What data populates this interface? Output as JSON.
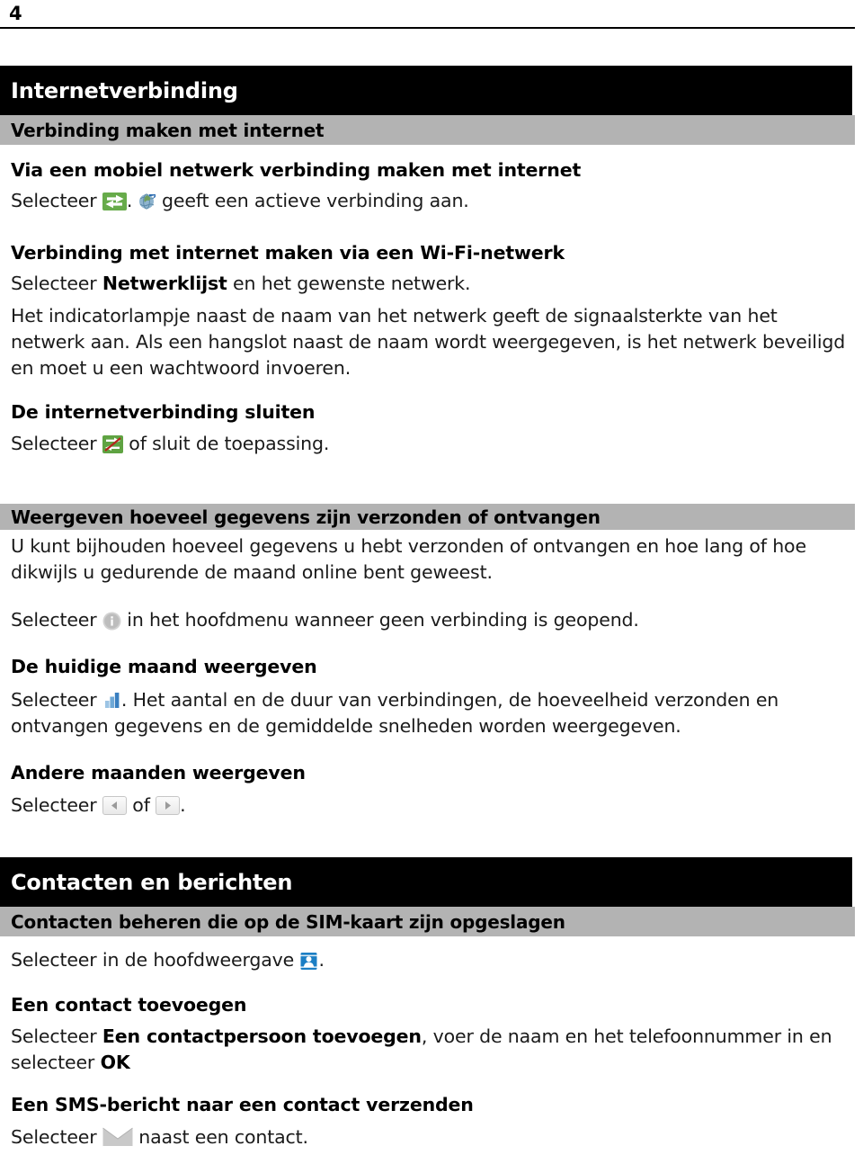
{
  "page": {
    "number": "4"
  },
  "chapters": [
    {
      "title": "Internetverbinding",
      "subtitle": "Verbinding maken met internet"
    },
    {
      "title": "Contacten en berichten",
      "subtitle": "Contacten beheren die op de SIM-kaart zijn opgeslagen"
    }
  ],
  "sections": {
    "mobiel_heading": "Via een mobiel netwerk verbinding maken met internet",
    "mobiel_line_pre": "Selecteer",
    "mobiel_line_mid": ".",
    "mobiel_line_post": "geeft een actieve verbinding aan.",
    "wifi_heading": "Verbinding met internet maken via een Wi-Fi-netwerk",
    "wifi_line1_pre": "Selecteer",
    "wifi_line1_bold": "Netwerklijst",
    "wifi_line1_post": "en het gewenste netwerk.",
    "wifi_para": "Het indicatorlampje naast de naam van het netwerk geeft de signaalsterkte van het netwerk aan. Als een hangslot naast de naam wordt weergegeven, is het netwerk beveiligd en moet u een wachtwoord invoeren.",
    "sluiten_heading": "De internetverbinding sluiten",
    "sluiten_pre": "Selecteer",
    "sluiten_post": "of sluit de toepassing.",
    "weergeven_bar": "Weergeven hoeveel gegevens zijn verzonden of ontvangen",
    "weergeven_para": "U kunt bijhouden hoeveel gegevens u hebt verzonden of ontvangen en hoe lang of hoe dikwijls u gedurende de maand online bent geweest.",
    "weergeven_line_pre": "Selecteer",
    "weergeven_line_post": "in het hoofdmenu wanneer geen verbinding is geopend.",
    "huidige_heading": "De huidige maand weergeven",
    "huidige_pre": "Selecteer",
    "huidige_post": ". Het aantal en de duur van verbindingen, de hoeveelheid verzonden en ontvangen gegevens en de gemiddelde snelheden worden weergegeven.",
    "andere_heading": "Andere maanden weergeven",
    "andere_pre": "Selecteer",
    "andere_mid": "of",
    "andere_post": ".",
    "simkaart_pre": "Selecteer in de hoofdweergave",
    "simkaart_post": ".",
    "contact_toevoegen_heading": "Een contact toevoegen",
    "contact_toevoegen_pre": "Selecteer",
    "contact_toevoegen_bold": "Een contactpersoon toevoegen",
    "contact_toevoegen_mid": ", voer de naam en het telefoonnummer in en selecteer",
    "contact_toevoegen_bold2": "OK",
    "sms_heading": "Een SMS-bericht naar een contact verzenden",
    "sms_pre": "Selecteer",
    "sms_post": "naast een contact."
  },
  "icons": {
    "transfer": "transfer-arrows-icon",
    "globe": "globe-active-connection-icon",
    "disconnect": "disconnect-icon",
    "info": "info-icon",
    "chart": "bar-chart-icon",
    "prev": "arrow-left-icon",
    "next": "arrow-right-icon",
    "contacts": "contacts-card-icon",
    "envelope": "envelope-icon"
  },
  "colors": {
    "chapter_bar": "#000000",
    "sub_bar": "#b3b3b3",
    "icon_green": "#67ab4a",
    "icon_blue": "#3a86c8",
    "icon_gray": "#b8b8b8"
  }
}
